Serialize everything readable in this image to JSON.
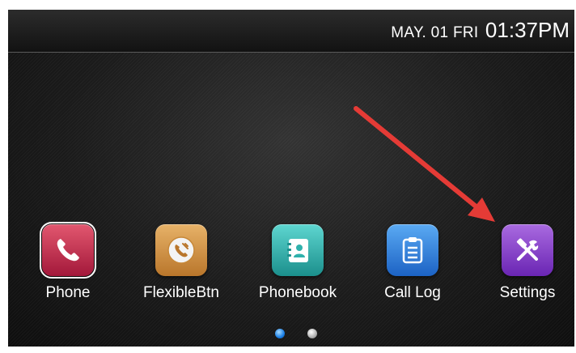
{
  "status_bar": {
    "date": "MAY. 01 FRI",
    "time": "01:37PM"
  },
  "apps": [
    {
      "label": "Phone",
      "icon": "phone-handset-icon",
      "color": "#c0284a"
    },
    {
      "label": "FlexibleBtn",
      "icon": "flexible-button-icon",
      "color": "#d8963f"
    },
    {
      "label": "Phonebook",
      "icon": "contact-book-icon",
      "color": "#2fb1ac"
    },
    {
      "label": "Call Log",
      "icon": "call-log-clipboard-icon",
      "color": "#2c7fdd"
    },
    {
      "label": "Settings",
      "icon": "tools-wrench-hammer-icon",
      "color": "#8a3fcf"
    }
  ],
  "page_indicator": {
    "pages": 2,
    "current": 1
  },
  "annotation": {
    "arrow_color": "#e53b36",
    "points_to": "Settings"
  }
}
